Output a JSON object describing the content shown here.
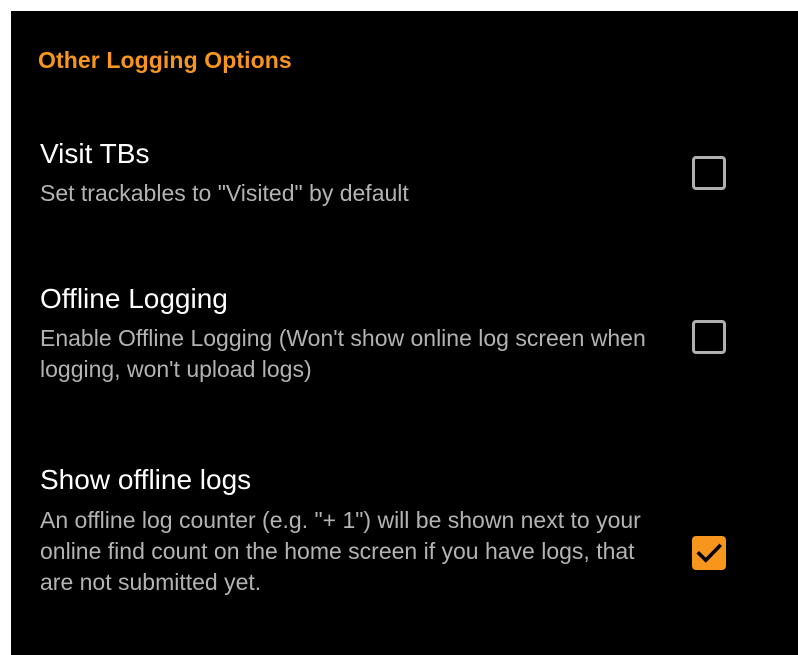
{
  "section": {
    "header": "Other Logging Options"
  },
  "preferences": [
    {
      "title": "Visit TBs",
      "summary": "Set trackables to \"Visited\" by default",
      "checked": false
    },
    {
      "title": "Offline Logging",
      "summary": "Enable Offline Logging (Won't show online log screen when logging, won't upload logs)",
      "checked": false
    },
    {
      "title": "Show offline logs",
      "summary": "An offline log counter (e.g. \"+ 1\") will be shown next to your online find count on the home screen if you have logs, that are not submitted yet.",
      "checked": true
    }
  ],
  "colors": {
    "background": "#000000",
    "accent": "#f7961d",
    "title_text": "#ffffff",
    "summary_text": "#b3b3b3",
    "checkbox_border": "#b0b0b0"
  }
}
